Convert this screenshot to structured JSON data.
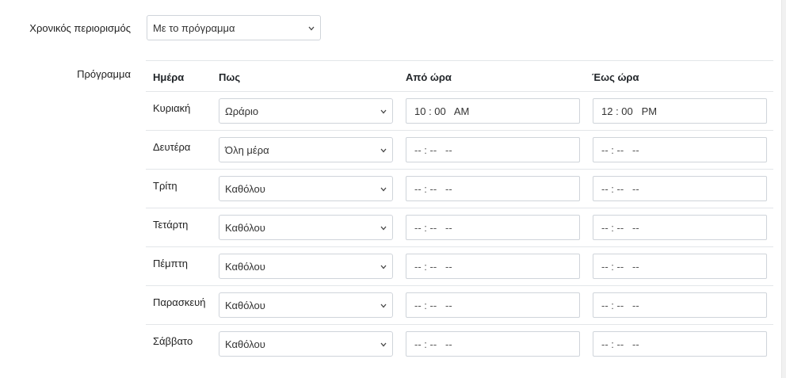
{
  "restriction": {
    "label": "Χρονικός περιορισμός",
    "value": "Με το πρόγραμμα"
  },
  "schedule": {
    "label": "Πρόγραμμα",
    "headers": {
      "day": "Ημέρα",
      "how": "Πως",
      "from": "Από ώρα",
      "to": "Έως ώρα"
    },
    "rows": [
      {
        "day": "Κυριακή",
        "how": "Ωράριο",
        "from": "10 : 00   AM",
        "to": "12 : 00   PM"
      },
      {
        "day": "Δευτέρα",
        "how": "Όλη μέρα",
        "from": "-- : --   --",
        "to": "-- : --   --"
      },
      {
        "day": "Τρίτη",
        "how": "Καθόλου",
        "from": "-- : --   --",
        "to": "-- : --   --"
      },
      {
        "day": "Τετάρτη",
        "how": "Καθόλου",
        "from": "-- : --   --",
        "to": "-- : --   --"
      },
      {
        "day": "Πέμπτη",
        "how": "Καθόλου",
        "from": "-- : --   --",
        "to": "-- : --   --"
      },
      {
        "day": "Παρασκευή",
        "how": "Καθόλου",
        "from": "-- : --   --",
        "to": "-- : --   --"
      },
      {
        "day": "Σάββατο",
        "how": "Καθόλου",
        "from": "-- : --   --",
        "to": "-- : --   --"
      }
    ]
  },
  "icons": {
    "dropdown": "chevron-down-icon"
  },
  "colors": {
    "border": "#cfd4da",
    "divider": "#e3e6e9"
  }
}
